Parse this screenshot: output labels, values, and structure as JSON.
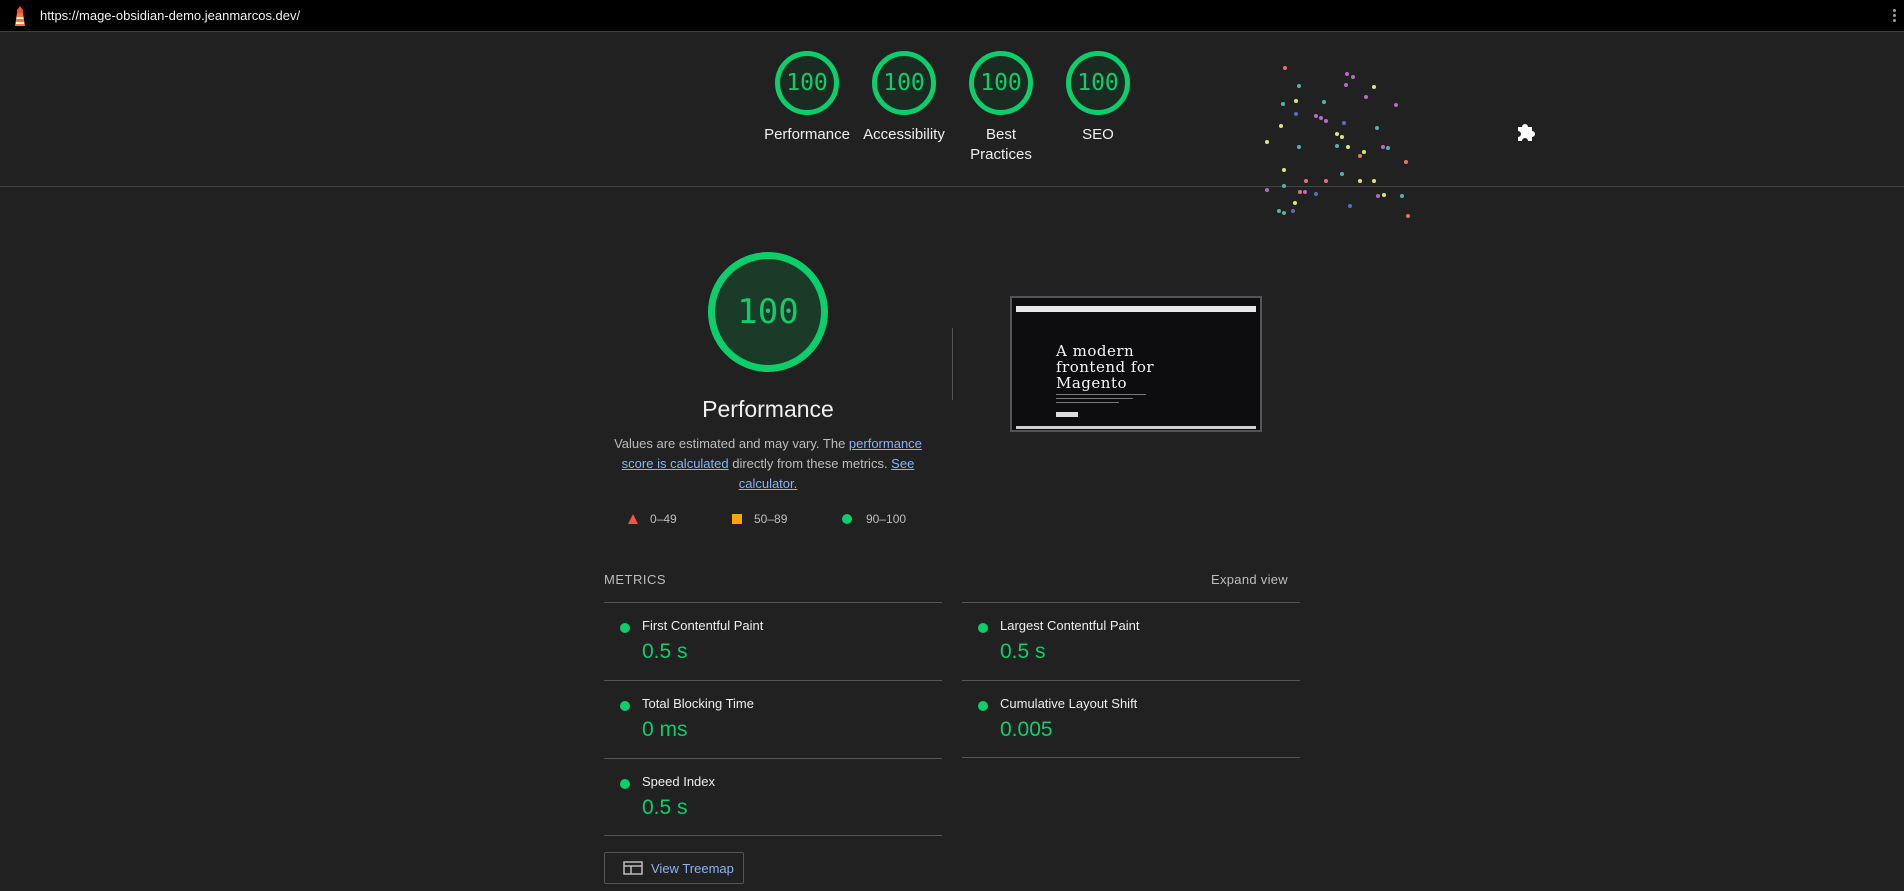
{
  "topbar": {
    "url": "https://mage-obsidian-demo.jeanmarcos.dev/"
  },
  "gauges": [
    {
      "score": "100",
      "label": "Performance"
    },
    {
      "score": "100",
      "label": "Accessibility"
    },
    {
      "score": "100",
      "label": "Best Practices"
    },
    {
      "score": "100",
      "label": "SEO"
    }
  ],
  "performance": {
    "score": "100",
    "title": "Performance",
    "desc_prefix": "Values are estimated and may vary. The ",
    "desc_link1": "performance score is calculated",
    "desc_middle": " directly from these metrics. ",
    "desc_link2": "See calculator."
  },
  "legend": {
    "fail": "0–49",
    "average": "50–89",
    "pass": "90–100"
  },
  "screenshot": {
    "hero_line1": "A modern",
    "hero_line2": "frontend for",
    "hero_line3": "Magento"
  },
  "metrics": {
    "title": "METRICS",
    "expand": "Expand view",
    "items": [
      {
        "name": "First Contentful Paint",
        "value": "0.5 s"
      },
      {
        "name": "Largest Contentful Paint",
        "value": "0.5 s"
      },
      {
        "name": "Total Blocking Time",
        "value": "0 ms"
      },
      {
        "name": "Cumulative Layout Shift",
        "value": "0.005"
      },
      {
        "name": "Speed Index",
        "value": "0.5 s"
      }
    ]
  },
  "treemap": {
    "label": "View Treemap"
  },
  "colors": {
    "pass": "#0cce6b",
    "average": "#ffa400",
    "fail": "#ff4e42",
    "link": "#8ab4f8",
    "background": "#212121"
  }
}
